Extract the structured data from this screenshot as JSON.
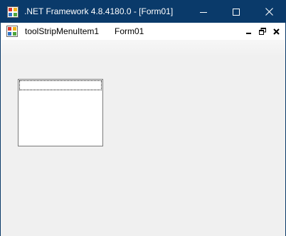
{
  "window": {
    "title": ".NET Framework 4.8.4180.0 - [Form01]",
    "icon": "winforms-app-icon",
    "controls": {
      "minimize": "minimize-icon",
      "maximize": "maximize-icon",
      "close": "close-icon"
    }
  },
  "menubar": {
    "mdi_icon": "mdi-child-form-icon",
    "items": [
      {
        "label": "toolStripMenuItem1"
      },
      {
        "label": "Form01"
      }
    ],
    "mdi_controls": {
      "minimize": "mdi-minimize-icon",
      "restore": "mdi-restore-icon",
      "close": "mdi-close-icon"
    }
  },
  "listbox": {
    "items": [],
    "focused_index": 0
  },
  "colors": {
    "titlebar": "#0a3a6a",
    "client_background": "#f0f0f0",
    "menubar": "#ffffff"
  }
}
